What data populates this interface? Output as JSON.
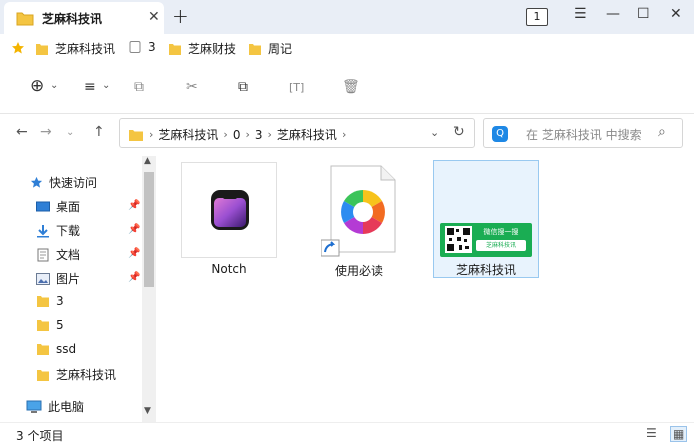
{
  "window": {
    "tab_title": "芝麻科技讯",
    "tab_count": "1",
    "close_tab": "✕",
    "new_tab": "+",
    "menu": "☰",
    "minimize": "—",
    "maximize": "☐",
    "close": "✕"
  },
  "bookmarks": [
    {
      "label": "芝麻科技讯",
      "icon": "folder-icon"
    },
    {
      "label": "3",
      "icon": "file-icon"
    },
    {
      "label": "芝麻财技",
      "icon": "folder-icon"
    },
    {
      "label": "周记",
      "icon": "folder-icon"
    }
  ],
  "toolbar": {
    "new": "⊕",
    "new_dd": "⌄",
    "view": "≡",
    "view_dd": "⌄",
    "copy": "⧉",
    "cut": "✂",
    "copy_path": "⧉",
    "rename": "[T]",
    "delete": "🗑"
  },
  "nav": {
    "back": "←",
    "forward": "→",
    "recent": "⌄",
    "up": "↑"
  },
  "address": {
    "crumbs": [
      "芝麻科技讯",
      "0",
      "3",
      "芝麻科技讯"
    ],
    "sep": "›",
    "dropdown": "⌄",
    "refresh": "↻"
  },
  "search": {
    "badge": "Q",
    "placeholder": "在 芝麻科技讯 中搜索",
    "icon": "⌕"
  },
  "sidebar": {
    "quick_access": "快速访问",
    "items": [
      {
        "label": "桌面",
        "icon": "desktop-icon",
        "pinned": true
      },
      {
        "label": "下载",
        "icon": "download-icon",
        "pinned": true
      },
      {
        "label": "文档",
        "icon": "document-icon",
        "pinned": true
      },
      {
        "label": "图片",
        "icon": "image-icon",
        "pinned": true
      },
      {
        "label": "3",
        "icon": "folder-icon",
        "pinned": false
      },
      {
        "label": "5",
        "icon": "folder-icon",
        "pinned": false
      },
      {
        "label": "ssd",
        "icon": "folder-icon",
        "pinned": false
      },
      {
        "label": "芝麻科技讯",
        "icon": "folder-icon",
        "pinned": false
      }
    ],
    "this_pc": "此电脑",
    "pin_glyph": "📌",
    "scroll_up": "▲",
    "scroll_down": "▼"
  },
  "files": [
    {
      "label": "Notch",
      "icon": "notch-app-icon"
    },
    {
      "label": "使用必读",
      "icon": "shortcut-document-icon"
    },
    {
      "label": "芝麻科技讯",
      "icon": "wechat-qr-card-image",
      "selected": true
    }
  ],
  "wechat_card": {
    "title": "微信搜一搜",
    "subtitle": "芝麻科技讯"
  },
  "status": {
    "count": "3 个项目",
    "details_view": "☰",
    "icons_view": "▦"
  },
  "colors": {
    "folder": "#f4c542",
    "accent": "#0078d4",
    "wechat_green": "#1aad53"
  }
}
